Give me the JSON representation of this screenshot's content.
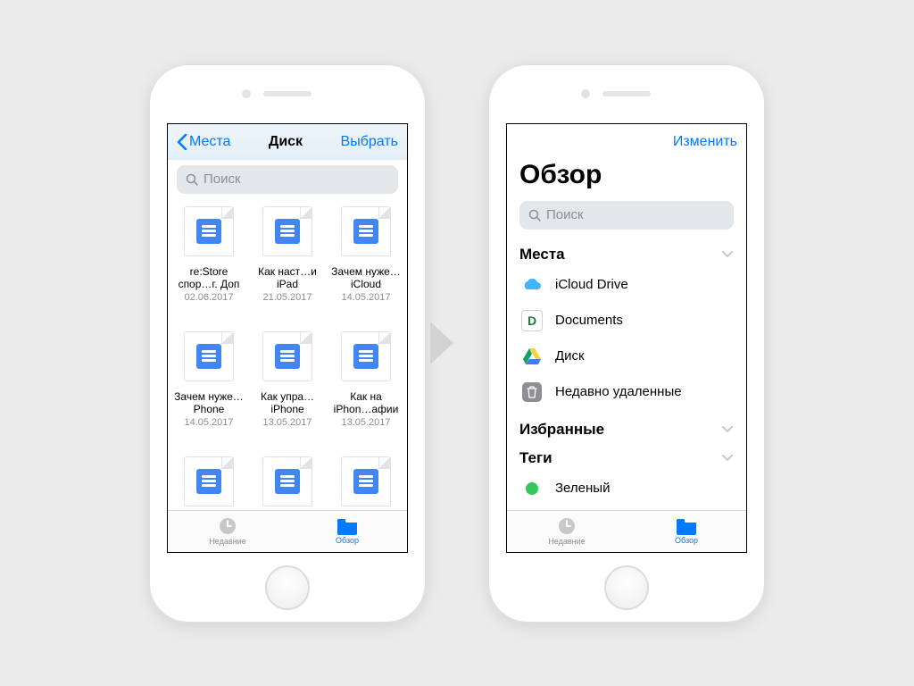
{
  "colors": {
    "accent": "#007aff",
    "grey": "#8e8e93",
    "tag_green": "#34c759"
  },
  "left": {
    "nav": {
      "back": "Места",
      "title": "Диск",
      "action": "Выбрать"
    },
    "search": {
      "placeholder": "Поиск"
    },
    "files": [
      {
        "name": "re:Store спор…г. Доп",
        "date": "02.06.2017"
      },
      {
        "name": "Как наст…и iPad",
        "date": "21.05.2017"
      },
      {
        "name": "Зачем нуже…iCloud",
        "date": "14.05.2017"
      },
      {
        "name": "Зачем нуже…Phone",
        "date": "14.05.2017"
      },
      {
        "name": "Как упра…iPhone",
        "date": "13.05.2017"
      },
      {
        "name": "Как на iPhon…афии",
        "date": "13.05.2017"
      },
      {
        "name": "",
        "date": ""
      },
      {
        "name": "",
        "date": ""
      },
      {
        "name": "",
        "date": ""
      }
    ]
  },
  "right": {
    "nav": {
      "action": "Изменить"
    },
    "title": "Обзор",
    "search": {
      "placeholder": "Поиск"
    },
    "sections": {
      "places": {
        "label": "Места",
        "items": [
          {
            "icon": "icloud",
            "label": "iCloud Drive"
          },
          {
            "icon": "documents",
            "label": "Documents"
          },
          {
            "icon": "gdrive",
            "label": "Диск"
          },
          {
            "icon": "trash",
            "label": "Недавно удаленные"
          }
        ]
      },
      "favorites": {
        "label": "Избранные"
      },
      "tags": {
        "label": "Теги",
        "items": [
          {
            "color": "#34c759",
            "label": "Зеленый"
          }
        ]
      }
    }
  },
  "tabs": {
    "recent": "Недавние",
    "browse": "Обзор"
  }
}
